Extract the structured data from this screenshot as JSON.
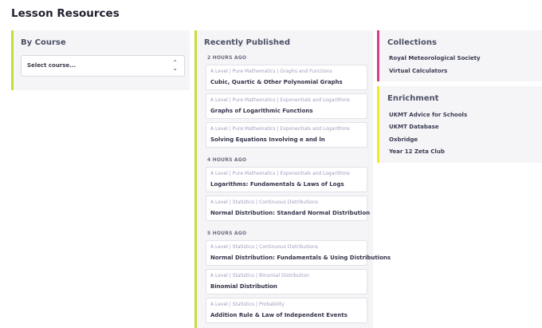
{
  "page": {
    "title": "Lesson Resources"
  },
  "by_course": {
    "heading": "By Course",
    "select": {
      "value": "Select course..."
    }
  },
  "recent": {
    "heading": "Recently Published",
    "groups": [
      {
        "label": "2 HOURS AGO",
        "items": [
          {
            "crumb": "A Level | Pure Mathematics | Graphs and Functions",
            "title": "Cubic, Quartic & Other Polynomial Graphs"
          },
          {
            "crumb": "A Level | Pure Mathematics | Exponentials and Logarithms",
            "title": "Graphs of Logarithmic Functions"
          },
          {
            "crumb": "A Level | Pure Mathematics | Exponentials and Logarithms",
            "title": "Solving Equations Involving e and ln"
          }
        ]
      },
      {
        "label": "4 HOURS AGO",
        "items": [
          {
            "crumb": "A Level | Pure Mathematics | Exponentials and Logarithms",
            "title": "Logarithms: Fundamentals & Laws of Logs"
          },
          {
            "crumb": "A Level | Statistics | Continuous Distributions",
            "title": "Normal Distribution: Standard Normal Distribution"
          }
        ]
      },
      {
        "label": "5 HOURS AGO",
        "items": [
          {
            "crumb": "A Level | Statistics | Continuous Distributions",
            "title": "Normal Distribution: Fundamentals & Using Distributions"
          },
          {
            "crumb": "A Level | Statistics | Binomial Distribution",
            "title": "Binomial Distribution"
          },
          {
            "crumb": "A Level | Statistics | Probability",
            "title": "Addition Rule & Law of Independent Events"
          }
        ]
      }
    ]
  },
  "collections": {
    "heading": "Collections",
    "items": [
      "Royal Meteorological Society",
      "Virtual Calculators"
    ]
  },
  "enrichment": {
    "heading": "Enrichment",
    "items": [
      "UKMT Advice for Schools",
      "UKMT Database",
      "Oxbridge",
      "Year 12 Zeta Club"
    ]
  },
  "colors": {
    "course_accent": "#c9dc35",
    "recent_accent": "#c9dc35",
    "collections_accent": "#d63e86",
    "enrichment_accent": "#f1e826"
  },
  "icons": {
    "select_arrow": "chevron-up-down-icon"
  }
}
